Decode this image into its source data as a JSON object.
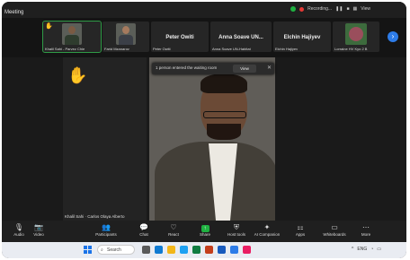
{
  "window": {
    "title": "Meeting",
    "recording_label": "Recording...",
    "view_label": "View"
  },
  "participants_strip": [
    {
      "label": "Khalil Sahi - Parvez Chie",
      "type": "photo",
      "active": true
    },
    {
      "label": "Farid Mzanarov",
      "type": "photo",
      "active": false
    },
    {
      "name": "Peter Owiti",
      "label": "Peter Owiti"
    },
    {
      "name": "Anna Soave UN...",
      "label": "Anna Soave UN-Habitat"
    },
    {
      "name": "Elchin Hajiyev",
      "label": "Elchin Hajiyev"
    },
    {
      "label": "Lorraine HV Kyo 2 B",
      "type": "flower"
    }
  ],
  "main": {
    "raised_hand_label": "Khalil Sahi · Carlos Olaya Alberto",
    "waiting_room": {
      "message": "1 person entered the waiting room",
      "view_button": "View"
    }
  },
  "toolbar": [
    {
      "label": "Audio",
      "icon": "mic-icon",
      "glyph": "🎙"
    },
    {
      "label": "Video",
      "icon": "camera-icon",
      "glyph": "📷"
    },
    {
      "label": "Participants",
      "icon": "people-icon",
      "glyph": "👥"
    },
    {
      "label": "Chat",
      "icon": "chat-icon",
      "glyph": "💬"
    },
    {
      "label": "React",
      "icon": "react-icon",
      "glyph": "♡"
    },
    {
      "label": "Share",
      "icon": "share-icon",
      "glyph": "↑"
    },
    {
      "label": "Host tools",
      "icon": "shield-icon",
      "glyph": "⛨"
    },
    {
      "label": "AI Companion",
      "icon": "sparkle-icon",
      "glyph": "✦"
    },
    {
      "label": "Apps",
      "icon": "apps-icon",
      "glyph": "⚏"
    },
    {
      "label": "Whiteboards",
      "icon": "whiteboard-icon",
      "glyph": "▭"
    },
    {
      "label": "More",
      "icon": "more-icon",
      "glyph": "⋯"
    }
  ],
  "taskbar": {
    "search_placeholder": "Search",
    "tray": "ENG"
  },
  "colors": {
    "green": "#1fb141",
    "blue": "#2d7ce8"
  }
}
